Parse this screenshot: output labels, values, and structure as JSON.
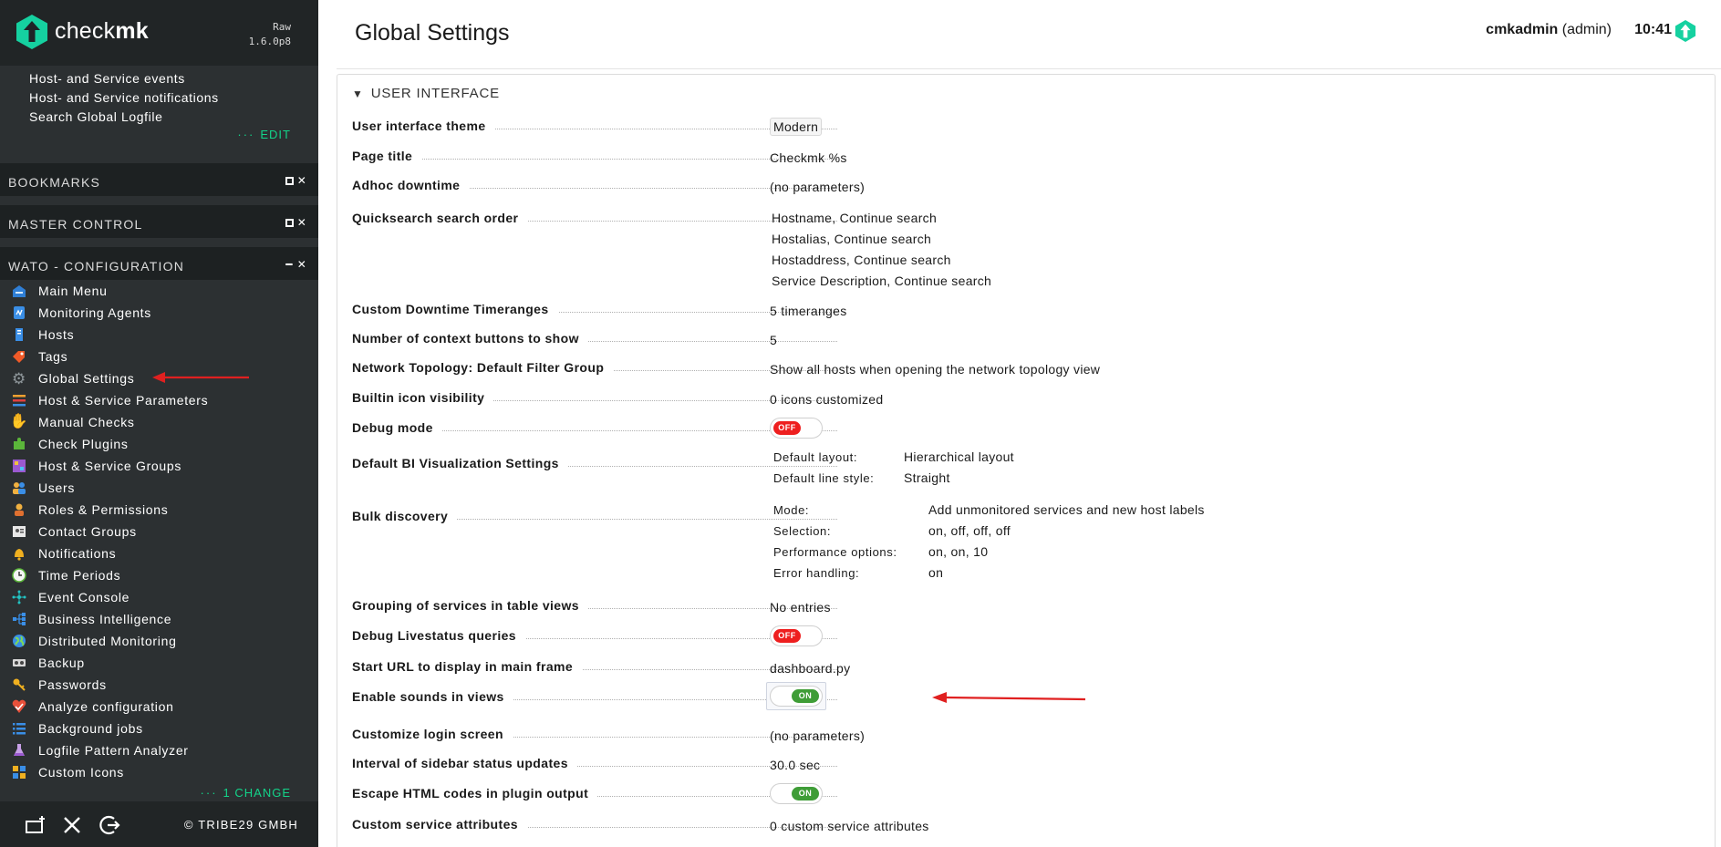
{
  "brand": {
    "name_light": "check",
    "name_bold": "mk",
    "edition": "Raw",
    "version": "1.6.0p8"
  },
  "sidebar": {
    "top_links": [
      "Host- and Service events",
      "Host- and Service notifications",
      "Search Global Logfile"
    ],
    "edit_label": "EDIT",
    "snapins": {
      "bookmarks": "BOOKMARKS",
      "master_control": "MASTER CONTROL",
      "wato": "WATO - CONFIGURATION"
    },
    "wato_items": [
      {
        "label": "Main Menu",
        "icon": "main-menu-icon"
      },
      {
        "label": "Monitoring Agents",
        "icon": "agents-icon"
      },
      {
        "label": "Hosts",
        "icon": "hosts-icon"
      },
      {
        "label": "Tags",
        "icon": "tags-icon"
      },
      {
        "label": "Global Settings",
        "icon": "gear-icon"
      },
      {
        "label": "Host & Service Parameters",
        "icon": "parameters-icon"
      },
      {
        "label": "Manual Checks",
        "icon": "manual-checks-icon"
      },
      {
        "label": "Check Plugins",
        "icon": "plugins-icon"
      },
      {
        "label": "Host & Service Groups",
        "icon": "groups-icon"
      },
      {
        "label": "Users",
        "icon": "users-icon"
      },
      {
        "label": "Roles & Permissions",
        "icon": "roles-icon"
      },
      {
        "label": "Contact Groups",
        "icon": "contact-groups-icon"
      },
      {
        "label": "Notifications",
        "icon": "bell-icon"
      },
      {
        "label": "Time Periods",
        "icon": "clock-icon"
      },
      {
        "label": "Event Console",
        "icon": "event-console-icon"
      },
      {
        "label": "Business Intelligence",
        "icon": "bi-icon"
      },
      {
        "label": "Distributed Monitoring",
        "icon": "globe-icon"
      },
      {
        "label": "Backup",
        "icon": "backup-icon"
      },
      {
        "label": "Passwords",
        "icon": "key-icon"
      },
      {
        "label": "Analyze configuration",
        "icon": "analyze-icon"
      },
      {
        "label": "Background jobs",
        "icon": "background-jobs-icon"
      },
      {
        "label": "Logfile Pattern Analyzer",
        "icon": "flask-icon"
      },
      {
        "label": "Custom Icons",
        "icon": "custom-icons-icon"
      }
    ],
    "change_label": "1 CHANGE",
    "copyright": "© TRIBE29 GMBH"
  },
  "header": {
    "title": "Global Settings",
    "user": "cmkadmin",
    "role": "(admin)",
    "time": "10:41"
  },
  "section": {
    "title": "USER INTERFACE"
  },
  "settings": {
    "theme": {
      "label": "User interface theme",
      "value": "Modern"
    },
    "page_title": {
      "label": "Page title",
      "value": "Checkmk %s"
    },
    "adhoc": {
      "label": "Adhoc downtime",
      "value": "(no parameters)"
    },
    "quicksearch": {
      "label": "Quicksearch search order",
      "values": [
        "Hostname, Continue search",
        "Hostalias, Continue search",
        "Hostaddress, Continue search",
        "Service Description, Continue search"
      ]
    },
    "timeranges": {
      "label": "Custom Downtime Timeranges",
      "value": "5 timeranges"
    },
    "context_buttons": {
      "label": "Number of context buttons to show",
      "value": "5"
    },
    "topology": {
      "label": "Network Topology: Default Filter Group",
      "value": "Show all hosts when opening the network topology view"
    },
    "icon_visibility": {
      "label": "Builtin icon visibility",
      "value": "0 icons customized"
    },
    "debug_mode": {
      "label": "Debug mode",
      "state": "OFF"
    },
    "bi_vis": {
      "label": "Default BI Visualization Settings",
      "layout_key": "Default layout:",
      "layout_value": "Hierarchical layout",
      "line_key": "Default line style:",
      "line_value": "Straight"
    },
    "bulk": {
      "label": "Bulk discovery",
      "mode_key": "Mode:",
      "mode_value": "Add unmonitored services and new host labels",
      "selection_key": "Selection:",
      "selection_value": "on, off, off, off",
      "perf_key": "Performance options:",
      "perf_value": "on, on, 10",
      "error_key": "Error handling:",
      "error_value": "on"
    },
    "grouping": {
      "label": "Grouping of services in table views",
      "value": "No entries"
    },
    "debug_livestatus": {
      "label": "Debug Livestatus queries",
      "state": "OFF"
    },
    "start_url": {
      "label": "Start URL to display in main frame",
      "value": "dashboard.py"
    },
    "sounds": {
      "label": "Enable sounds in views",
      "state": "ON"
    },
    "login": {
      "label": "Customize login screen",
      "value": "(no parameters)"
    },
    "interval": {
      "label": "Interval of sidebar status updates",
      "value": "30.0 sec"
    },
    "escape_html": {
      "label": "Escape HTML codes in plugin output",
      "state": "ON"
    },
    "custom_attrs": {
      "label": "Custom service attributes",
      "value": "0 custom service attributes"
    }
  },
  "colors": {
    "sidebar_bg": "#2c3032",
    "accent_green": "#13d389",
    "toggle_off": "#ee1f1f",
    "toggle_on": "#3f9d37",
    "annotation_arrow": "#e02020"
  }
}
